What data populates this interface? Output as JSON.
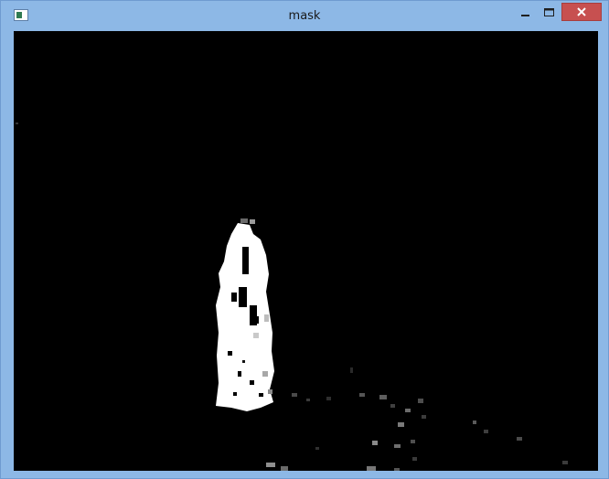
{
  "window": {
    "title": "mask",
    "app_icon": "app-window-icon",
    "controls": {
      "minimize_icon": "minimize-icon",
      "maximize_icon": "maximize-icon",
      "close_icon": "close-icon"
    }
  },
  "image": {
    "description_icon": "binary-mask-image"
  },
  "colors": {
    "titlebar": "#8db8e6",
    "close_button": "#c75050",
    "canvas": "#000000",
    "foreground": "#ffffff"
  }
}
